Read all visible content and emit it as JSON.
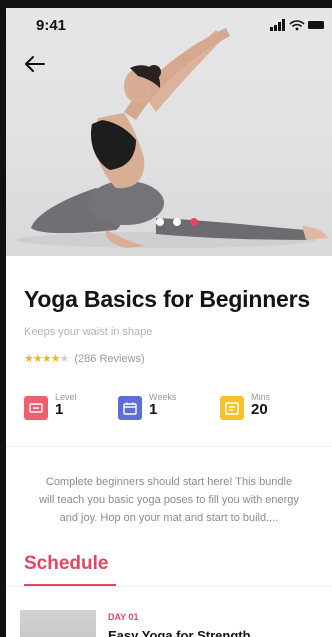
{
  "status_bar": {
    "time": "9:41"
  },
  "header": {
    "back_icon": "arrow-left-icon"
  },
  "carousel": {
    "count": 3,
    "active_index": 2,
    "accent": "#e6475d"
  },
  "course": {
    "title": "Yoga Basics for Beginners",
    "subtitle": "Keeps your waist in shape",
    "rating": 4,
    "rating_max": 5,
    "reviews": "(286 Reviews)"
  },
  "stats": [
    {
      "label": "Level",
      "value": "1",
      "icon": "level-icon",
      "color": "#ee5f72"
    },
    {
      "label": "Weeks",
      "value": "1",
      "icon": "calendar-icon",
      "color": "#5b6fd6"
    },
    {
      "label": "Mins",
      "value": "20",
      "icon": "timer-icon",
      "color": "#f5c22a"
    }
  ],
  "description": {
    "line1": "Complete beginners should start here! This bundle",
    "line2": "will teach you basic yoga poses to fill you with energy",
    "line3": "and joy. Hop on your mat and start to build...."
  },
  "tabs": {
    "schedule": "Schedule"
  },
  "schedule": [
    {
      "day": "DAY 01",
      "title": "Easy Yoga for Strength"
    }
  ]
}
